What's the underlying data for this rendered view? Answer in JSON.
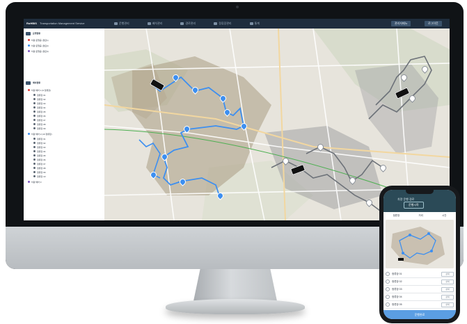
{
  "app": {
    "brand": "RoHBIS",
    "title": "Transportation Management Service"
  },
  "topnav": [
    {
      "label": "운행관리"
    },
    {
      "label": "배차관리"
    },
    {
      "label": "경로관리"
    },
    {
      "label": "정류장관리"
    },
    {
      "label": "통계"
    }
  ],
  "topbar_buttons": {
    "left": "관리자메뉴",
    "right": "로그아웃"
  },
  "sidebar": {
    "section1_title": "운행현황",
    "section1_rows": [
      {
        "label": "차량 운행중 (경로1)",
        "color": "#e53935"
      },
      {
        "label": "차량 운행중 (경로2)",
        "color": "#3d8ff0"
      },
      {
        "label": "차량 운행중 (경로3)",
        "color": "#7e57c2"
      }
    ],
    "section2_title": "배차현황",
    "section2_groups": [
      {
        "label": "차량 배차 1 (9 정류장)",
        "color": "#e53935",
        "children": [
          "정류장 01",
          "정류장 02",
          "정류장 03",
          "정류장 04",
          "정류장 05",
          "정류장 06",
          "정류장 07",
          "정류장 08",
          "정류장 09"
        ]
      },
      {
        "label": "차량 배차 2 (10 정류장)",
        "color": "#3d8ff0",
        "children": [
          "정류장 01",
          "정류장 02",
          "정류장 03",
          "정류장 04",
          "정류장 05",
          "정류장 06",
          "정류장 07",
          "정류장 08",
          "정류장 09",
          "정류장 10"
        ]
      },
      {
        "label": "차량 배차 3",
        "color": "#7e57c2",
        "children": []
      }
    ]
  },
  "phone": {
    "title": "차량 운행 경로",
    "button": "운행시작",
    "stats": [
      "정류장",
      "거리",
      "시간"
    ],
    "list": [
      "정류장 01",
      "정류장 02",
      "정류장 03",
      "정류장 04",
      "정류장 05"
    ],
    "list_action": "상세",
    "footer": "운행완료"
  },
  "colors": {
    "route_blue": "#3d8ff0",
    "route_grey": "#6d7279",
    "topbar": "#1f2d3d"
  }
}
